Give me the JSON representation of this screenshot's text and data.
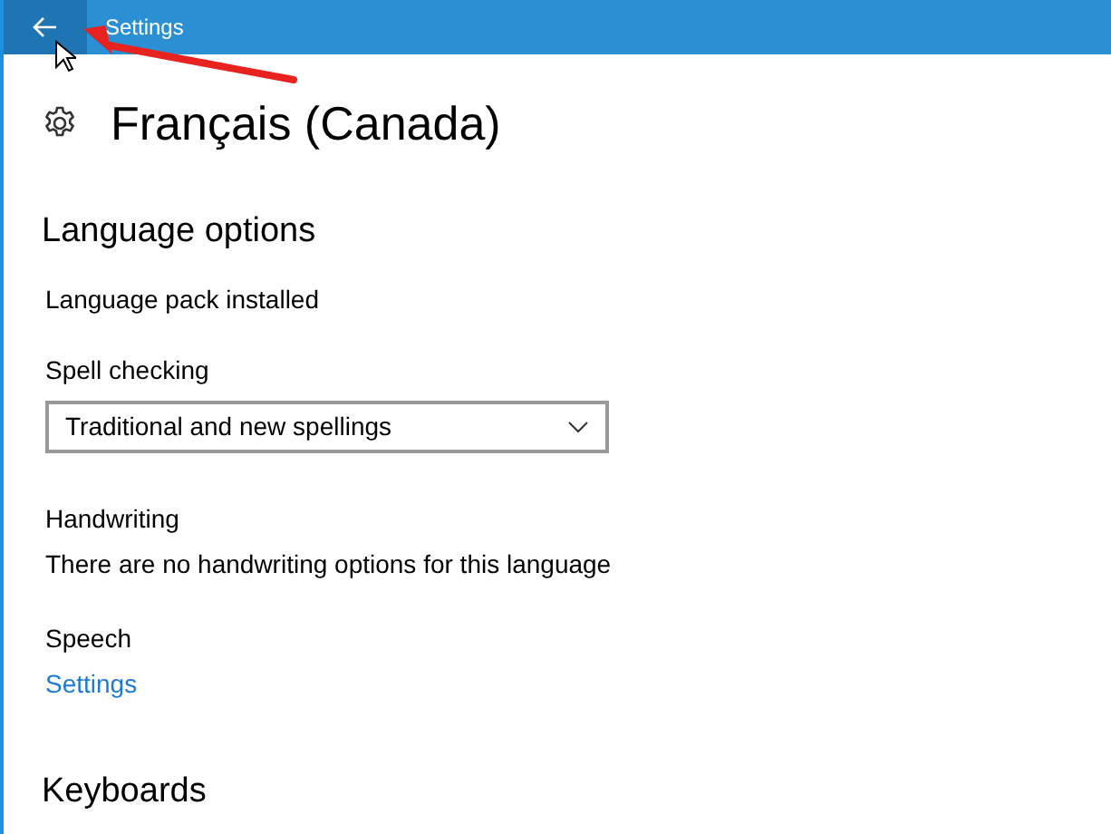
{
  "window": {
    "title": "Settings"
  },
  "page": {
    "title": "Français (Canada)"
  },
  "section": {
    "title": "Language options"
  },
  "status": "Language pack installed",
  "spell_checking": {
    "label": "Spell checking",
    "value": "Traditional and new spellings"
  },
  "handwriting": {
    "label": "Handwriting",
    "text": "There are no handwriting options for this language"
  },
  "speech": {
    "label": "Speech",
    "link": "Settings"
  },
  "next_section": {
    "title": "Keyboards"
  }
}
